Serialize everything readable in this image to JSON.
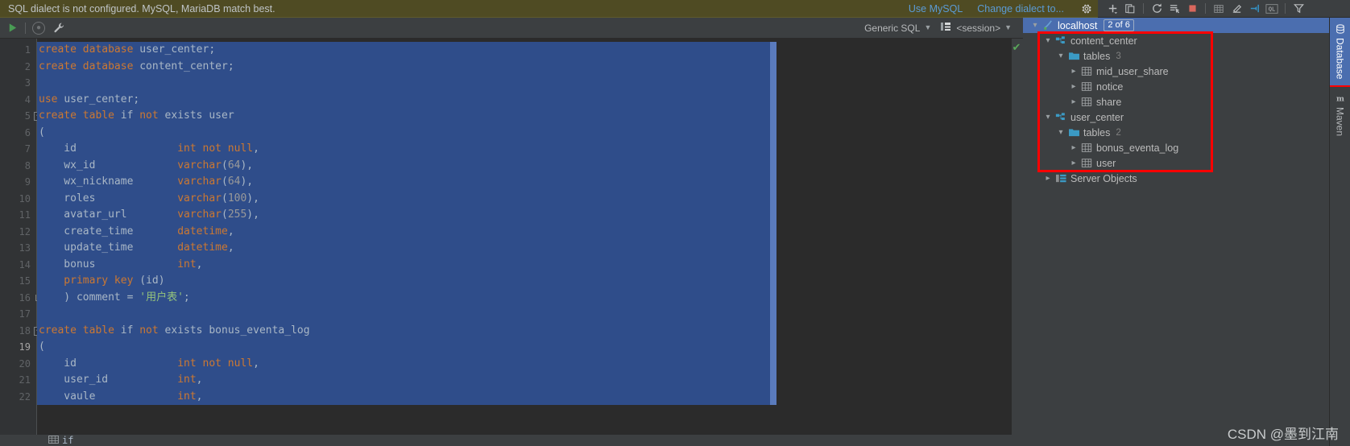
{
  "notification": {
    "message": "SQL dialect is not configured. MySQL, MariaDB match best.",
    "use_mysql_label": "Use MySQL",
    "change_dialect_label": "Change dialect to...",
    "gear_icon": "gear-icon",
    "bg_color": "#4f4b23",
    "link_color": "#5b9bd5"
  },
  "db_toolbar": {
    "buttons": [
      {
        "name": "add-data-source-button",
        "icon": "plus-icon",
        "glyph": "+"
      },
      {
        "name": "copy-data-source-button",
        "icon": "copy-icon",
        "glyph": ""
      },
      {
        "name": "refresh-button",
        "icon": "refresh-icon",
        "glyph": ""
      },
      {
        "name": "jump-to-query-console-button",
        "icon": "console-icon",
        "glyph": ""
      },
      {
        "name": "stop-button",
        "icon": "stop-square-icon",
        "glyph": ""
      },
      {
        "name": "open-table-editor-button",
        "icon": "table-icon",
        "glyph": ""
      },
      {
        "name": "modify-object-button",
        "icon": "pencil-icon",
        "glyph": ""
      },
      {
        "name": "jump-to-editor-button",
        "icon": "jump-to-source-icon",
        "glyph": ""
      },
      {
        "name": "qlicon-button",
        "icon": "ql-icon",
        "glyph": "QL"
      },
      {
        "name": "filter-button",
        "icon": "funnel-icon",
        "glyph": ""
      }
    ]
  },
  "editor_toolbar": {
    "run_button": {
      "name": "run-button",
      "icon": "play-triangle-icon",
      "color": "#499c54"
    },
    "stop_button": {
      "name": "stop-button",
      "icon": "circle-stop-icon"
    },
    "settings_button": {
      "name": "settings-wrench-button",
      "icon": "wrench-icon"
    },
    "dialect": {
      "label": "Generic SQL",
      "chevron": "chevron-down-icon"
    },
    "session": {
      "label": "<session>",
      "icon": "session-icon",
      "chevron": "chevron-down-icon"
    }
  },
  "editor": {
    "inspection_badge": {
      "name": "inspection-ok-badge",
      "glyph": "✔",
      "color": "#5aa85a"
    },
    "current_line": 19,
    "selection_color": "#2f4d8a",
    "lines": [
      {
        "n": 1,
        "fold": null,
        "tokens": [
          [
            "kw",
            "create database "
          ],
          [
            "id",
            "user_center"
          ],
          [
            "pn",
            ";"
          ]
        ]
      },
      {
        "n": 2,
        "fold": null,
        "tokens": [
          [
            "kw",
            "create database "
          ],
          [
            "id",
            "content_center"
          ],
          [
            "pn",
            ";"
          ]
        ]
      },
      {
        "n": 3,
        "fold": null,
        "tokens": []
      },
      {
        "n": 4,
        "fold": null,
        "tokens": [
          [
            "kw",
            "use "
          ],
          [
            "id",
            "user_center"
          ],
          [
            "pn",
            ";"
          ]
        ]
      },
      {
        "n": 5,
        "fold": "start",
        "tokens": [
          [
            "kw",
            "create table "
          ],
          [
            "id",
            "if "
          ],
          [
            "kw",
            "not "
          ],
          [
            "id",
            "exists user"
          ]
        ]
      },
      {
        "n": 6,
        "fold": null,
        "tokens": [
          [
            "pn",
            "("
          ]
        ]
      },
      {
        "n": 7,
        "fold": null,
        "tokens": [
          [
            "id",
            "    id                "
          ],
          [
            "kw",
            "int not null"
          ],
          [
            "pn",
            ","
          ]
        ]
      },
      {
        "n": 8,
        "fold": null,
        "tokens": [
          [
            "id",
            "    wx_id             "
          ],
          [
            "kw",
            "varchar"
          ],
          [
            "pn",
            "("
          ],
          [
            "num",
            "64"
          ],
          [
            "pn",
            "),"
          ]
        ]
      },
      {
        "n": 9,
        "fold": null,
        "tokens": [
          [
            "id",
            "    wx_nickname       "
          ],
          [
            "kw",
            "varchar"
          ],
          [
            "pn",
            "("
          ],
          [
            "num",
            "64"
          ],
          [
            "pn",
            "),"
          ]
        ]
      },
      {
        "n": 10,
        "fold": null,
        "tokens": [
          [
            "id",
            "    roles             "
          ],
          [
            "kw",
            "varchar"
          ],
          [
            "pn",
            "("
          ],
          [
            "num",
            "100"
          ],
          [
            "pn",
            "),"
          ]
        ]
      },
      {
        "n": 11,
        "fold": null,
        "tokens": [
          [
            "id",
            "    avatar_url        "
          ],
          [
            "kw",
            "varchar"
          ],
          [
            "pn",
            "("
          ],
          [
            "num",
            "255"
          ],
          [
            "pn",
            "),"
          ]
        ]
      },
      {
        "n": 12,
        "fold": null,
        "tokens": [
          [
            "id",
            "    create_time       "
          ],
          [
            "kw",
            "datetime"
          ],
          [
            "pn",
            ","
          ]
        ]
      },
      {
        "n": 13,
        "fold": null,
        "tokens": [
          [
            "id",
            "    update_time       "
          ],
          [
            "kw",
            "datetime"
          ],
          [
            "pn",
            ","
          ]
        ]
      },
      {
        "n": 14,
        "fold": null,
        "tokens": [
          [
            "id",
            "    bonus             "
          ],
          [
            "kw",
            "int"
          ],
          [
            "pn",
            ","
          ]
        ]
      },
      {
        "n": 15,
        "fold": null,
        "tokens": [
          [
            "kw",
            "    primary key "
          ],
          [
            "pn",
            "("
          ],
          [
            "id",
            "id"
          ],
          [
            "pn",
            ")"
          ]
        ]
      },
      {
        "n": 16,
        "fold": "end",
        "tokens": [
          [
            "pn",
            "    ) "
          ],
          [
            "id",
            "comment "
          ],
          [
            "pn",
            "= "
          ],
          [
            "str",
            "'用户表'"
          ],
          [
            "pn",
            ";"
          ]
        ]
      },
      {
        "n": 17,
        "fold": null,
        "tokens": []
      },
      {
        "n": 18,
        "fold": "start",
        "tokens": [
          [
            "kw",
            "create table "
          ],
          [
            "id",
            "if "
          ],
          [
            "kw",
            "not "
          ],
          [
            "id",
            "exists bonus_eventa_log"
          ]
        ]
      },
      {
        "n": 19,
        "fold": null,
        "tokens": [
          [
            "pn",
            "("
          ]
        ]
      },
      {
        "n": 20,
        "fold": null,
        "tokens": [
          [
            "id",
            "    id                "
          ],
          [
            "kw",
            "int not null"
          ],
          [
            "pn",
            ","
          ]
        ]
      },
      {
        "n": 21,
        "fold": null,
        "tokens": [
          [
            "id",
            "    user_id           "
          ],
          [
            "kw",
            "int"
          ],
          [
            "pn",
            ","
          ]
        ]
      },
      {
        "n": 22,
        "fold": null,
        "tokens": [
          [
            "id",
            "    vaule             "
          ],
          [
            "kw",
            "int"
          ],
          [
            "pn",
            ","
          ]
        ]
      }
    ],
    "bottom_bar_label": "if"
  },
  "db_tree": {
    "rows": [
      {
        "indent": 0,
        "twisty": "down",
        "icon": "database-connection-icon",
        "label": "localhost",
        "count": null,
        "badge": "2 of 6",
        "selected": true
      },
      {
        "indent": 1,
        "twisty": "down",
        "icon": "schema-icon",
        "label": "content_center",
        "count": null,
        "badge": null,
        "selected": false
      },
      {
        "indent": 2,
        "twisty": "down",
        "icon": "folder-icon",
        "label": "tables",
        "count": "3",
        "badge": null,
        "selected": false
      },
      {
        "indent": 3,
        "twisty": "right",
        "icon": "table-icon",
        "label": "mid_user_share",
        "count": null,
        "badge": null,
        "selected": false
      },
      {
        "indent": 3,
        "twisty": "right",
        "icon": "table-icon",
        "label": "notice",
        "count": null,
        "badge": null,
        "selected": false
      },
      {
        "indent": 3,
        "twisty": "right",
        "icon": "table-icon",
        "label": "share",
        "count": null,
        "badge": null,
        "selected": false
      },
      {
        "indent": 1,
        "twisty": "down",
        "icon": "schema-icon",
        "label": "user_center",
        "count": null,
        "badge": null,
        "selected": false
      },
      {
        "indent": 2,
        "twisty": "down",
        "icon": "folder-icon",
        "label": "tables",
        "count": "2",
        "badge": null,
        "selected": false
      },
      {
        "indent": 3,
        "twisty": "right",
        "icon": "table-icon",
        "label": "bonus_eventa_log",
        "count": null,
        "badge": null,
        "selected": false
      },
      {
        "indent": 3,
        "twisty": "right",
        "icon": "table-icon",
        "label": "user",
        "count": null,
        "badge": null,
        "selected": false
      },
      {
        "indent": 1,
        "twisty": "right",
        "icon": "server-objects-icon",
        "label": "Server Objects",
        "count": null,
        "badge": null,
        "selected": false
      }
    ],
    "highlight_color": "#ff0000"
  },
  "side_tabs": [
    {
      "label": "Database",
      "icon": "database-icon",
      "active": true
    },
    {
      "label": "Maven",
      "icon": "maven-icon",
      "active": false
    }
  ],
  "watermark": "CSDN @墨到江南"
}
